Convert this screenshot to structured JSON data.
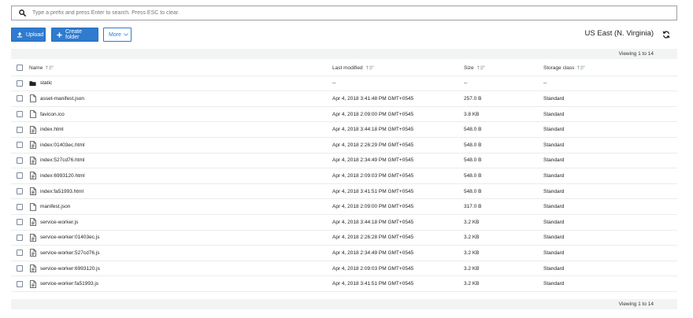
{
  "search": {
    "placeholder": "Type a prefix and press Enter to search. Press ESC to clear."
  },
  "toolbar": {
    "upload_label": "Upload",
    "create_folder_label": "Create folder",
    "more_label": "More",
    "region": "US East (N. Virginia)"
  },
  "viewing": {
    "top": "Viewing 1 to 14",
    "bottom": "Viewing 1 to 14"
  },
  "columns": {
    "name": "Name",
    "last_modified": "Last modified",
    "size": "Size",
    "storage_class": "Storage class"
  },
  "rows": [
    {
      "name": "static",
      "icon": "folder-icon",
      "modified": "--",
      "size": "--",
      "class": "--"
    },
    {
      "name": "asset-manifest.json",
      "icon": "file-icon",
      "modified": "Apr 4, 2018 3:41:48 PM GMT+0545",
      "size": "257.0 B",
      "class": "Standard"
    },
    {
      "name": "favicon.ico",
      "icon": "file-icon",
      "modified": "Apr 4, 2018 2:09:00 PM GMT+0545",
      "size": "3.8 KB",
      "class": "Standard"
    },
    {
      "name": "index.html",
      "icon": "text-file-icon",
      "modified": "Apr 4, 2018 3:44:18 PM GMT+0545",
      "size": "548.0 B",
      "class": "Standard"
    },
    {
      "name": "index:01403ec.html",
      "icon": "text-file-icon",
      "modified": "Apr 4, 2018 2:26:29 PM GMT+0545",
      "size": "548.0 B",
      "class": "Standard"
    },
    {
      "name": "index:527cd76.html",
      "icon": "text-file-icon",
      "modified": "Apr 4, 2018 2:34:49 PM GMT+0545",
      "size": "548.0 B",
      "class": "Standard"
    },
    {
      "name": "index:6993120.html",
      "icon": "text-file-icon",
      "modified": "Apr 4, 2018 2:09:03 PM GMT+0545",
      "size": "548.0 B",
      "class": "Standard"
    },
    {
      "name": "index:fa51993.html",
      "icon": "text-file-icon",
      "modified": "Apr 4, 2018 3:41:51 PM GMT+0545",
      "size": "548.0 B",
      "class": "Standard"
    },
    {
      "name": "manifest.json",
      "icon": "file-icon",
      "modified": "Apr 4, 2018 2:09:00 PM GMT+0545",
      "size": "317.0 B",
      "class": "Standard"
    },
    {
      "name": "service-worker.js",
      "icon": "text-file-icon",
      "modified": "Apr 4, 2018 3:44:18 PM GMT+0545",
      "size": "3.2 KB",
      "class": "Standard"
    },
    {
      "name": "service-worker:01403ec.js",
      "icon": "text-file-icon",
      "modified": "Apr 4, 2018 2:26:28 PM GMT+0545",
      "size": "3.2 KB",
      "class": "Standard"
    },
    {
      "name": "service-worker:527cd76.js",
      "icon": "text-file-icon",
      "modified": "Apr 4, 2018 2:34:49 PM GMT+0545",
      "size": "3.2 KB",
      "class": "Standard"
    },
    {
      "name": "service-worker:6993120.js",
      "icon": "text-file-icon",
      "modified": "Apr 4, 2018 2:09:03 PM GMT+0545",
      "size": "3.2 KB",
      "class": "Standard"
    },
    {
      "name": "service-worker:fa51993.js",
      "icon": "text-file-icon",
      "modified": "Apr 4, 2018 3:41:51 PM GMT+0545",
      "size": "3.2 KB",
      "class": "Standard"
    }
  ],
  "colors": {
    "primary": "#2e7bcf",
    "row_border": "#eaeded",
    "band": "#f2f3f3"
  }
}
